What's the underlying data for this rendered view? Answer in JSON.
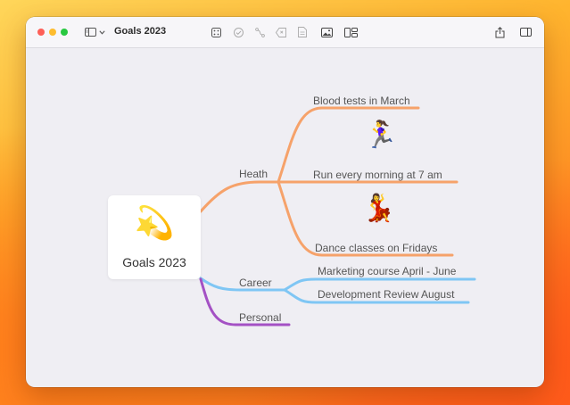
{
  "window": {
    "title": "Goals 2023"
  },
  "colors": {
    "health": "#f6a26a",
    "career": "#7fc6f4",
    "personal": "#a451c4"
  },
  "toolbar": {
    "icons": [
      "sidebar-icon",
      "chevron-down-icon",
      "add-node-icon",
      "checkmark-icon",
      "connection-icon",
      "tag-icon",
      "note-icon",
      "image-icon",
      "layout-icon",
      "share-icon",
      "inspector-icon"
    ]
  },
  "mindmap": {
    "root": {
      "emoji": "💫",
      "label": "Goals 2023"
    },
    "branches": [
      {
        "label": "Heath",
        "children": [
          {
            "label": "Blood tests in March",
            "emoji": ""
          },
          {
            "label": "Run every morning at 7 am",
            "emoji": "🏃‍♀️"
          },
          {
            "label": "Dance classes on Fridays",
            "emoji": "💃"
          }
        ]
      },
      {
        "label": "Career",
        "children": [
          {
            "label": "Marketing course April - June"
          },
          {
            "label": "Development Review August"
          }
        ]
      },
      {
        "label": "Personal",
        "children": []
      }
    ]
  }
}
